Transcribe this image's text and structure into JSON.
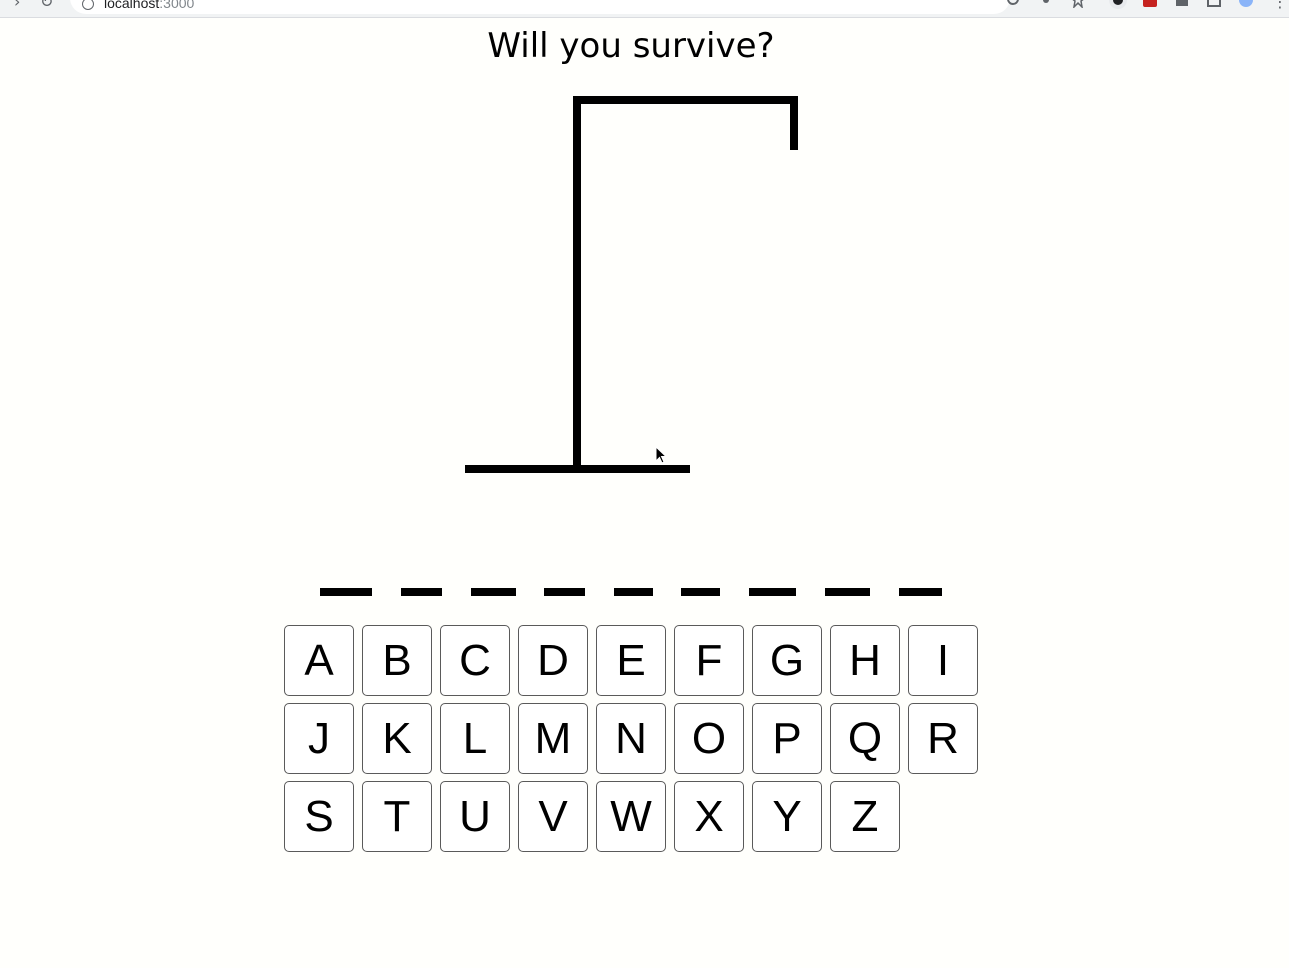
{
  "browser": {
    "url_host": "localhost",
    "url_port": ":3000"
  },
  "game": {
    "title": "Will you survive?",
    "word_length": 9,
    "wrong_guesses": 0
  },
  "keyboard": {
    "rows": [
      [
        "A",
        "B",
        "C",
        "D",
        "E",
        "F",
        "G",
        "H",
        "I"
      ],
      [
        "J",
        "K",
        "L",
        "M",
        "N",
        "O",
        "P",
        "Q",
        "R"
      ],
      [
        "S",
        "T",
        "U",
        "V",
        "W",
        "X",
        "Y",
        "Z"
      ]
    ]
  },
  "colors": {
    "background": "#fffffc",
    "ink": "#000000",
    "key_border": "#5a5a5a"
  }
}
